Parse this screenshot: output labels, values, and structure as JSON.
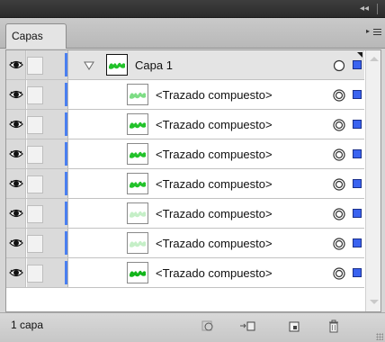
{
  "panel": {
    "tab_label": "Capas",
    "collapse_glyph": "◂◂"
  },
  "layers": [
    {
      "name": "Capa 1",
      "type": "layer",
      "expanded": true,
      "thumb_style": "solid"
    },
    {
      "name": "<Trazado compuesto>",
      "type": "path",
      "thumb_style": "light"
    },
    {
      "name": "<Trazado compuesto>",
      "type": "path",
      "thumb_style": "solid"
    },
    {
      "name": "<Trazado compuesto>",
      "type": "path",
      "thumb_style": "solid"
    },
    {
      "name": "<Trazado compuesto>",
      "type": "path",
      "thumb_style": "solid"
    },
    {
      "name": "<Trazado compuesto>",
      "type": "path",
      "thumb_style": "faint"
    },
    {
      "name": "<Trazado compuesto>",
      "type": "path",
      "thumb_style": "faint"
    },
    {
      "name": "<Trazado compuesto>",
      "type": "path",
      "thumb_style": "bold"
    }
  ],
  "status": {
    "layer_count": "1 capa"
  },
  "colors": {
    "layer_color": "#4a7ff0",
    "selection_square": "#3a63f0",
    "thumbnail_green": "#22c22a"
  },
  "icons": {
    "visibility": "eye-icon",
    "disclosure": "disclosure-triangle-icon",
    "target": "target-circle-icon",
    "make_clipping_mask": "clipping-mask-icon",
    "new_sublayer": "new-sublayer-icon",
    "new_layer": "new-layer-icon",
    "delete": "trash-icon",
    "panel_menu": "panel-menu-icon"
  }
}
